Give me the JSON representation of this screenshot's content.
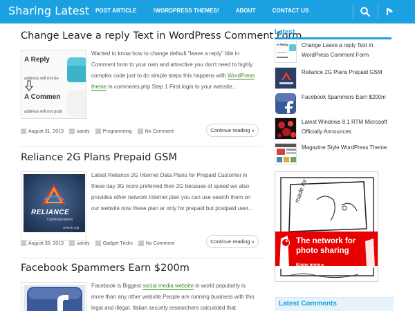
{
  "site": {
    "title": "Sharing Latest",
    "accent_color": "#1ba1e2",
    "nav": [
      "POST ARTICLE",
      "!WORDPRESS THEMES!",
      "ABOUT",
      "CONTACT US"
    ],
    "icons": [
      "search-icon",
      "rss-icon"
    ]
  },
  "posts": [
    {
      "title": "Change Leave a reply Text in WordPress Comment Form",
      "excerpt_before": "Wanted to know how to change default \"leave a reply\" title in Comment form to your own and attractive you don't need to highly complex code just to do simple steps this happens with ",
      "excerpt_link": "WordPress theme",
      "excerpt_after": " in comments.php Step 1 First login to your website...",
      "thumb_lines": [
        "A Reply",
        "address will not be",
        "A Commen",
        "address will not publ"
      ],
      "date": "August 31, 2013",
      "author": "sandy",
      "category": "Programming",
      "comments": "No Comment",
      "button": "Continue reading »"
    },
    {
      "title": "Reliance 2G Plans Prepaid GSM",
      "excerpt": "Latest Reliance 2G Internet Data Plans for Prepaid Customer in these day 3G more preferred then 2G because of speed we also provides other network Internet plan you can use search them on our website now these plan ar only for prepaid but postpaid user...",
      "thumb_lines": [
        "RELIANCE",
        "Communications",
        "www.b.org"
      ],
      "date": "August 30, 2013",
      "author": "sandy",
      "category": "Gadget Tricks",
      "comments": "No Comment",
      "button": "Continue reading »"
    },
    {
      "title": "Facebook Spammers Earn $200m",
      "excerpt_before": "Facebook is Biggest ",
      "excerpt_link": "social media website",
      "excerpt_after": " in world popularity is more than any other website.People are running business with this legal and illegal. Italian security researchers calculated that"
    }
  ],
  "sidebar": {
    "latest_heading": "Latest",
    "latest": [
      {
        "title": "Change Leave a reply Text in WordPress Comment Form",
        "thumb": "A Reply"
      },
      {
        "title": "Reliance 2G Plans Prepaid GSM"
      },
      {
        "title": "Facebook Spammers Earn $200m"
      },
      {
        "title": "Latest Windows 8.1 RTM Microsoft Officially Announces"
      },
      {
        "title": "Magazine Style WordPress Theme"
      }
    ],
    "ad": {
      "handwriting": "made for",
      "headline": "The network for photo sharing",
      "cta": "Know more ▸",
      "brand_color": "#e60000"
    },
    "comments_heading": "Latest Comments"
  }
}
